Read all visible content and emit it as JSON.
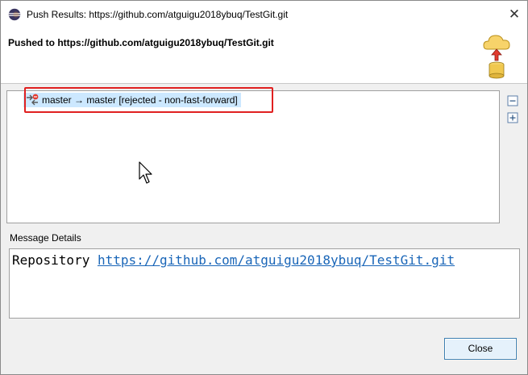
{
  "window": {
    "title": "Push Results: https://github.com/atguigu2018ybuq/TestGit.git",
    "close_glyph": "✕"
  },
  "banner": {
    "heading": "Pushed to https://github.com/atguigu2018ybuq/TestGit.git",
    "image_icon": "push-cloud-database-icon"
  },
  "results": {
    "items": [
      {
        "label": "master → master [rejected - non-fast-forward]",
        "icon": "branch-rejected-icon"
      }
    ],
    "toolbar": {
      "collapse_icon": "collapse-all-icon",
      "expand_icon": "expand-all-icon"
    }
  },
  "message_details": {
    "section_label": "Message Details",
    "prefix": "Repository ",
    "link": "https://github.com/atguigu2018ybuq/TestGit.git"
  },
  "buttons": {
    "close_label": "Close"
  },
  "colors": {
    "selection": "#cce8ff",
    "highlight_border": "#e02020",
    "link": "#1a66b8",
    "button_border": "#3c7fb1"
  }
}
